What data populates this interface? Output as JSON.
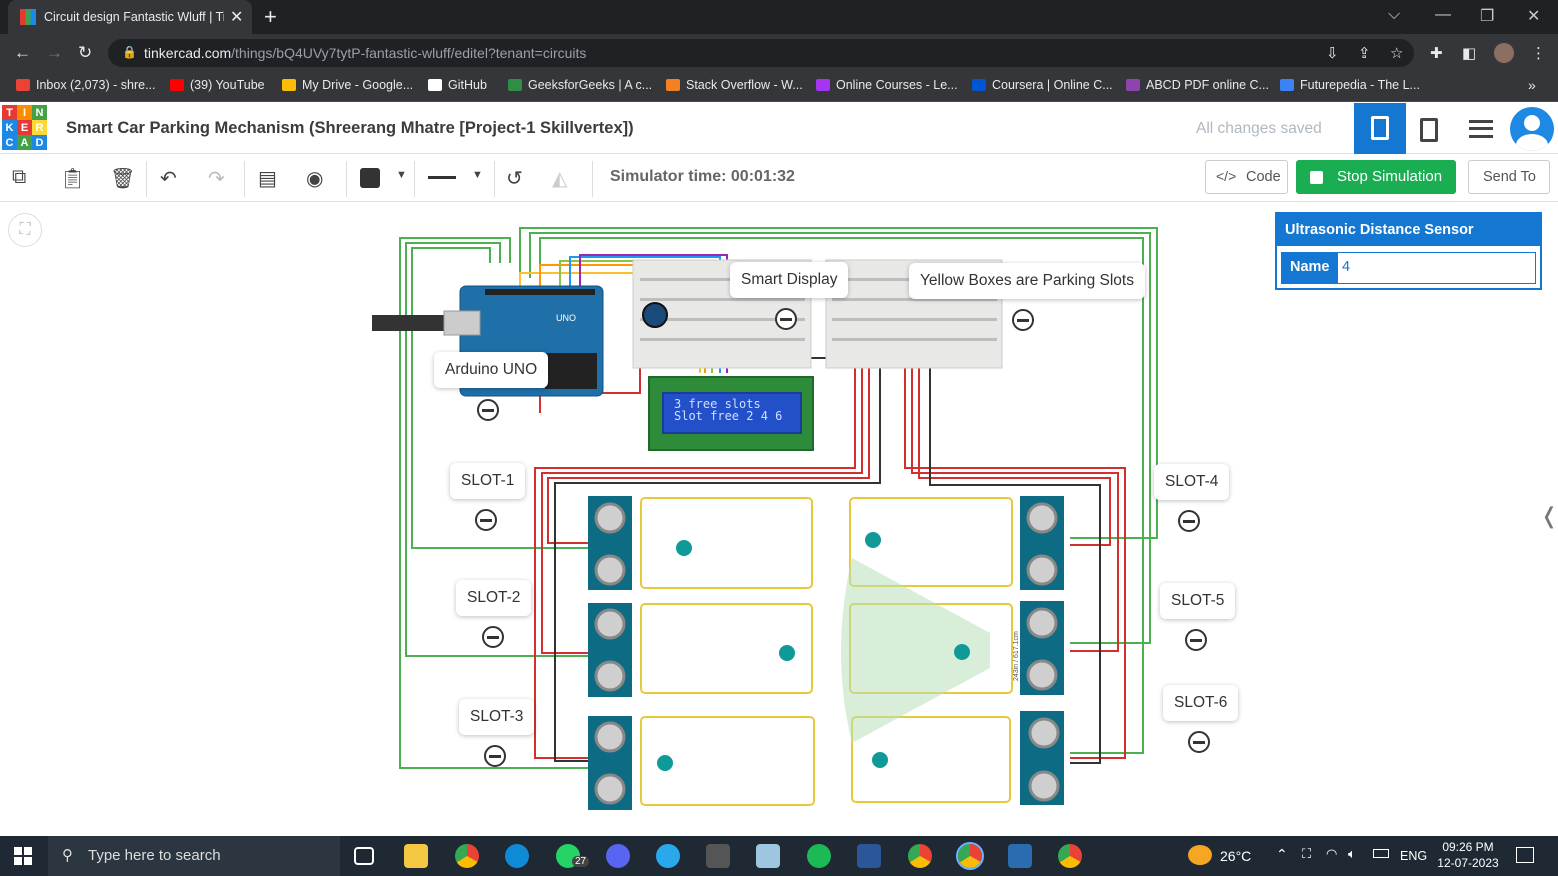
{
  "browser": {
    "tab_title": "Circuit design Fantastic Wluff | Ti",
    "url_domain": "tinkercad.com",
    "url_path": "/things/bQ4UVy7tytP-fantastic-wluff/editel?tenant=circuits",
    "bookmarks": [
      {
        "label": "Inbox (2,073) - shre...",
        "color": "#ea4335"
      },
      {
        "label": "(39) YouTube",
        "color": "#ff0000"
      },
      {
        "label": "My Drive - Google...",
        "color": "#fbbc04"
      },
      {
        "label": "GitHub",
        "color": "#ffffff"
      },
      {
        "label": "GeeksforGeeks | A c...",
        "color": "#2f8d46"
      },
      {
        "label": "Stack Overflow - W...",
        "color": "#f48024"
      },
      {
        "label": "Online Courses - Le...",
        "color": "#a435f0"
      },
      {
        "label": "Coursera | Online C...",
        "color": "#0056d2"
      },
      {
        "label": "ABCD PDF online C...",
        "color": "#8e44ad"
      },
      {
        "label": "Futurepedia - The L...",
        "color": "#3b82f6"
      }
    ]
  },
  "app": {
    "logo_letters": [
      "T",
      "I",
      "N",
      "K",
      "E",
      "R",
      "C",
      "A",
      "D"
    ],
    "title": "Smart Car Parking Mechanism (Shreerang Mhatre [Project-1 Skillvertex])",
    "save_status": "All changes saved"
  },
  "toolbar": {
    "simulator_time": "Simulator time: 00:01:32",
    "code_label": "Code",
    "stop_label": "Stop Simulation",
    "send_label": "Send To"
  },
  "inspector": {
    "title": "Ultrasonic Distance Sensor",
    "name_label": "Name",
    "name_value": "4"
  },
  "canvas": {
    "labels": {
      "arduino": "Arduino UNO",
      "smart_display": "Smart Display",
      "yellow_boxes": "Yellow Boxes are Parking Slots",
      "slot1": "SLOT-1",
      "slot2": "SLOT-2",
      "slot3": "SLOT-3",
      "slot4": "SLOT-4",
      "slot5": "SLOT-5",
      "slot6": "SLOT-6"
    },
    "lcd_line1": "3 free slots",
    "lcd_line2": "Slot free 2 4 6",
    "arduino_model": "UNO",
    "sensor_readout": "243in / 617.1cm"
  },
  "taskbar": {
    "search_placeholder": "Type here to search",
    "whatsapp_badge": "27",
    "weather": "26°C",
    "language": "ENG",
    "time": "09:26 PM",
    "date": "12-07-2023"
  },
  "colors": {
    "accent": "#1477d2",
    "stop_green": "#1aad52",
    "slot_yellow": "#e8c93a",
    "wire_green": "#4caf50",
    "wire_red": "#d32f2f"
  }
}
